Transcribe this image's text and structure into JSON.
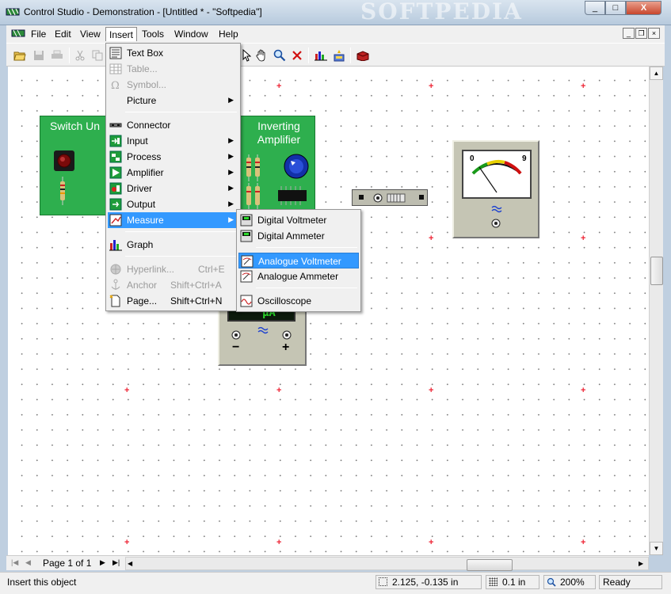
{
  "window": {
    "title": "Control Studio - Demonstration - [Untitled * - \"Softpedia\"]",
    "watermark": "SOFTPEDIA",
    "min_label": "_",
    "max_label": "□",
    "close_label": "X"
  },
  "menubar": {
    "items": [
      {
        "label": "File"
      },
      {
        "label": "Edit"
      },
      {
        "label": "View"
      },
      {
        "label": "Insert"
      },
      {
        "label": "Tools"
      },
      {
        "label": "Window"
      },
      {
        "label": "Help"
      }
    ],
    "mdi": {
      "min": "_",
      "restore": "❐",
      "close": "×"
    }
  },
  "canvas": {
    "blocks": {
      "switch_unit": {
        "title": "Switch Un"
      },
      "inverting_amplifier": {
        "title_line1": "Inverting",
        "title_line2": "Amplifier"
      }
    },
    "meter_digits": "µA",
    "meter_minus": "−",
    "meter_plus": "+",
    "analog_scale_low": "0",
    "analog_scale_high": "9"
  },
  "insert_menu": {
    "items": [
      {
        "label": "Text Box",
        "enabled": true
      },
      {
        "label": "Table...",
        "enabled": false
      },
      {
        "label": "Symbol...",
        "enabled": false
      },
      {
        "label": "Picture",
        "enabled": true,
        "submenu": true
      },
      {
        "label": "Connector",
        "enabled": true
      },
      {
        "label": "Input",
        "enabled": true,
        "submenu": true
      },
      {
        "label": "Process",
        "enabled": true,
        "submenu": true
      },
      {
        "label": "Amplifier",
        "enabled": true,
        "submenu": true
      },
      {
        "label": "Driver",
        "enabled": true,
        "submenu": true
      },
      {
        "label": "Output",
        "enabled": true,
        "submenu": true
      },
      {
        "label": "Measure",
        "enabled": true,
        "submenu": true,
        "highlighted": true
      },
      {
        "label": "Graph",
        "enabled": true
      },
      {
        "label": "Hyperlink...",
        "enabled": false,
        "shortcut": "Ctrl+E"
      },
      {
        "label": "Anchor",
        "enabled": false,
        "shortcut": "Shift+Ctrl+A"
      },
      {
        "label": "Page...",
        "enabled": true,
        "shortcut": "Shift+Ctrl+N"
      }
    ]
  },
  "measure_menu": {
    "items": [
      {
        "label": "Digital Voltmeter"
      },
      {
        "label": "Digital Ammeter"
      },
      {
        "label": "Analogue Voltmeter",
        "highlighted": true
      },
      {
        "label": "Analogue Ammeter"
      },
      {
        "label": "Oscilloscope"
      }
    ]
  },
  "navbar": {
    "page_label": "Page 1 of 1"
  },
  "statusbar": {
    "message": "Insert this object",
    "coords": "2.125, -0.135 in",
    "grid": "0.1 in",
    "zoom": "200%",
    "state": "Ready"
  },
  "colors": {
    "block_green": "#2eaf4e",
    "highlight": "#3399ff",
    "grid_plus": "#e23333"
  }
}
